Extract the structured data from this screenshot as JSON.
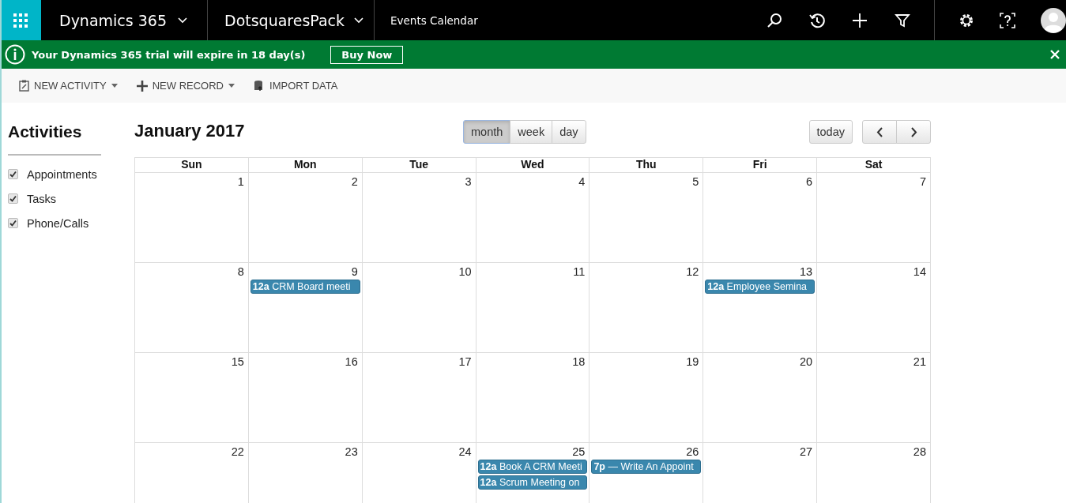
{
  "top_bar": {
    "app_name": "Dynamics 365",
    "module": "DotsquaresPack",
    "page": "Events Calendar"
  },
  "notification": {
    "message": "Your Dynamics 365 trial will expire in 18 day(s)",
    "action": "Buy Now"
  },
  "toolbar": [
    {
      "label": "NEW ACTIVITY",
      "kind": "activity",
      "dropdown": true
    },
    {
      "label": "NEW RECORD",
      "kind": "record",
      "dropdown": true
    },
    {
      "label": "IMPORT DATA",
      "kind": "import",
      "dropdown": false
    }
  ],
  "sidebar": {
    "title": "Activities",
    "filters": [
      {
        "label": "Appointments",
        "checked": true
      },
      {
        "label": "Tasks",
        "checked": true
      },
      {
        "label": "Phone/Calls",
        "checked": true
      }
    ]
  },
  "calendar": {
    "title": "January 2017",
    "views": [
      {
        "label": "month",
        "selected": true
      },
      {
        "label": "week",
        "selected": false
      },
      {
        "label": "day",
        "selected": false
      }
    ],
    "today_label": "today",
    "weekdays": [
      "Sun",
      "Mon",
      "Tue",
      "Wed",
      "Thu",
      "Fri",
      "Sat"
    ],
    "weeks": [
      [
        {
          "day": "1"
        },
        {
          "day": "2"
        },
        {
          "day": "3"
        },
        {
          "day": "4"
        },
        {
          "day": "5"
        },
        {
          "day": "6"
        },
        {
          "day": "7"
        }
      ],
      [
        {
          "day": "8"
        },
        {
          "day": "9",
          "events": [
            {
              "time": "12a",
              "title": "CRM Board meeti"
            }
          ]
        },
        {
          "day": "10"
        },
        {
          "day": "11"
        },
        {
          "day": "12"
        },
        {
          "day": "13",
          "events": [
            {
              "time": "12a",
              "title": "Employee Semina"
            }
          ]
        },
        {
          "day": "14"
        }
      ],
      [
        {
          "day": "15"
        },
        {
          "day": "16"
        },
        {
          "day": "17"
        },
        {
          "day": "18"
        },
        {
          "day": "19"
        },
        {
          "day": "20"
        },
        {
          "day": "21"
        }
      ],
      [
        {
          "day": "22"
        },
        {
          "day": "23"
        },
        {
          "day": "24"
        },
        {
          "day": "25",
          "events": [
            {
              "time": "12a",
              "title": "Book A CRM Meeti"
            },
            {
              "time": "12a",
              "title": "Scrum Meeting on"
            }
          ]
        },
        {
          "day": "26",
          "events": [
            {
              "time": "7p",
              "title": "— Write An Appoint"
            }
          ]
        },
        {
          "day": "27"
        },
        {
          "day": "28"
        }
      ]
    ]
  }
}
